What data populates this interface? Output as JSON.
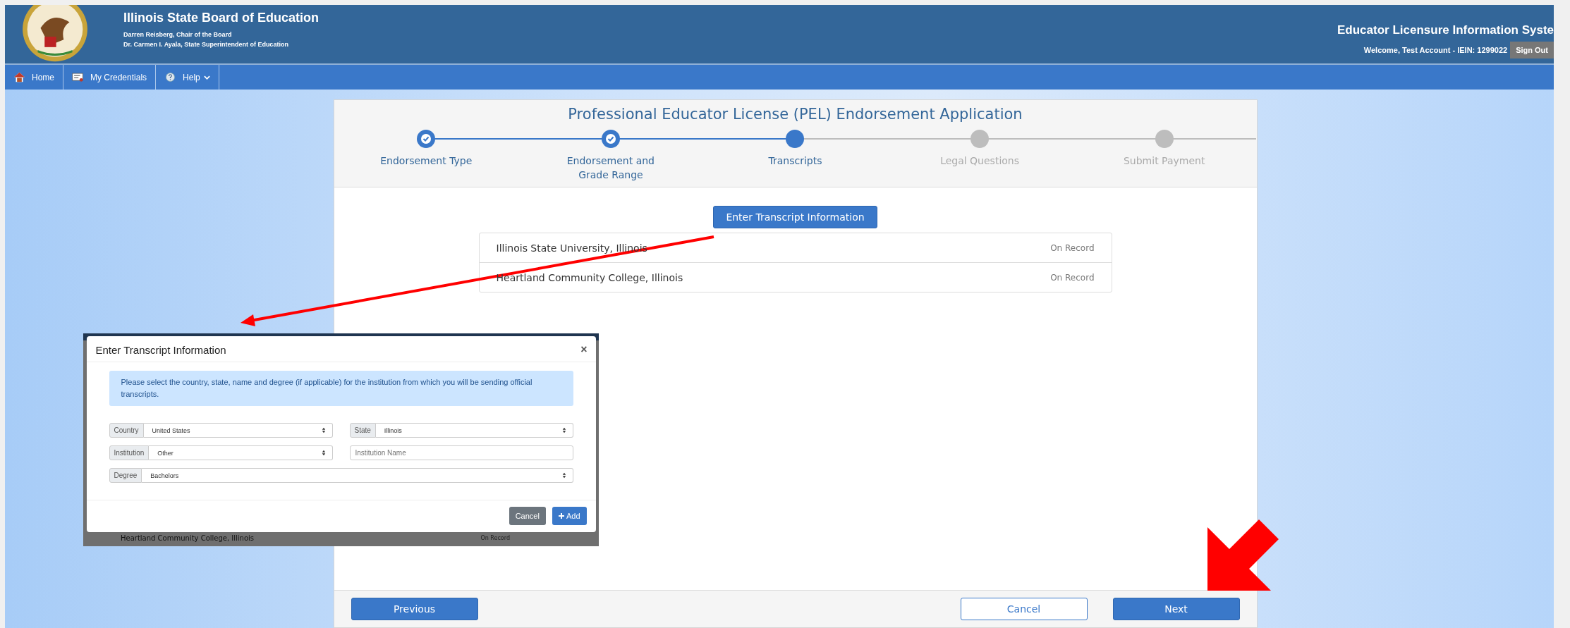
{
  "header": {
    "title": "Illinois State Board of Education",
    "subtitle_lines": [
      "Darren Reisberg, Chair of the Board",
      "Dr. Carmen I. Ayala, State Superintendent of Education"
    ],
    "system_title": "Educator Licensure Information Syste",
    "welcome": "Welcome, Test Account - IEIN: 1299022",
    "sign_out": "Sign Out"
  },
  "nav": [
    {
      "label": "Home",
      "kind": "home",
      "dropdown": false
    },
    {
      "label": "My Credentials",
      "kind": "credentials",
      "dropdown": false
    },
    {
      "label": "Help",
      "kind": "help",
      "dropdown": true
    }
  ],
  "application": {
    "title": "Professional Educator License (PEL) Endorsement Application",
    "steps": [
      {
        "label": "Endorsement Type",
        "completed": true,
        "selected": false
      },
      {
        "label": "Endorsement and Grade Range",
        "completed": true,
        "selected": false
      },
      {
        "label": "Transcripts",
        "completed": false,
        "selected": true
      },
      {
        "label": "Legal Questions",
        "completed": false,
        "selected": false
      },
      {
        "label": "Submit Payment",
        "completed": false,
        "selected": false
      }
    ],
    "enter_button": "Enter Transcript Information",
    "transcripts": [
      {
        "name": "Illinois State University, Illinois",
        "status": "On Record"
      },
      {
        "name": "Heartland Community College, Illinois",
        "status": "On Record"
      }
    ],
    "footer": {
      "previous": "Previous",
      "cancel": "Cancel",
      "next": "Next"
    }
  },
  "inset_modal": {
    "title": "Enter Transcript Information",
    "close": "×",
    "alert": "Please select the country, state, name and degree (if applicable) for the institution from which you will be sending official transcripts.",
    "rows": [
      [
        {
          "kind": "select",
          "label": "Country",
          "value": "United States"
        },
        {
          "kind": "select",
          "label": "State",
          "value": "Illinois"
        }
      ],
      [
        {
          "kind": "select",
          "label": "Institution",
          "value": "Other"
        },
        {
          "kind": "text",
          "placeholder": "Institution Name"
        }
      ],
      [
        {
          "kind": "select",
          "label": "Degree",
          "value": "Bachelors"
        }
      ]
    ],
    "cancel": "Cancel",
    "add": "Add",
    "behind_row": {
      "name": "Heartland Community College, Illinois",
      "status": "On Record"
    }
  }
}
